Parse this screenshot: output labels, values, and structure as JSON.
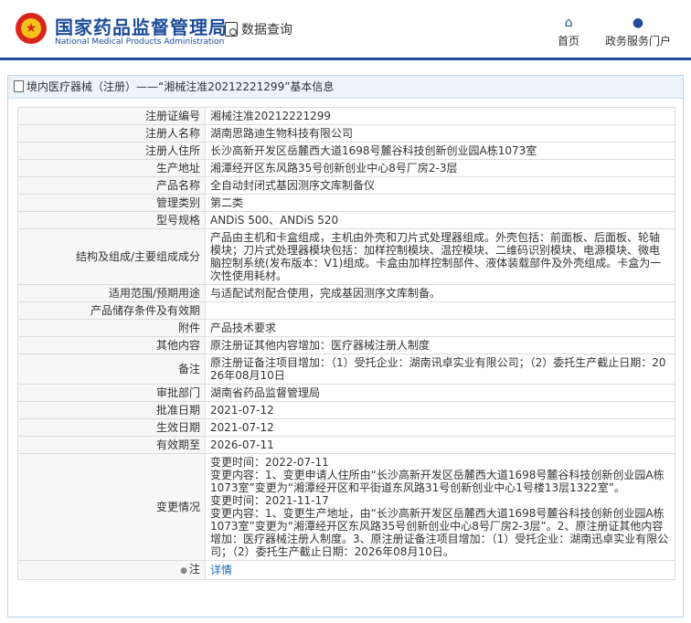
{
  "header": {
    "site_name_cn": "国家药品监督管理局",
    "site_name_en": "National Medical Products Administration",
    "query_label": "数据查询",
    "nav": [
      {
        "label": "首页",
        "icon": "home-icon"
      },
      {
        "label": "政务服务门户",
        "icon": "user-icon"
      }
    ]
  },
  "panel": {
    "title": "境内医疗器械（注册）——“湘械注准20212221299”基本信息"
  },
  "table": {
    "rows": [
      {
        "label": "注册证编号",
        "value": "湘械注准20212221299"
      },
      {
        "label": "注册人名称",
        "value": "湖南思路迪生物科技有限公司"
      },
      {
        "label": "注册人住所",
        "value": "长沙高新开发区岳麓西大道1698号麓谷科技创新创业园A栋1073室"
      },
      {
        "label": "生产地址",
        "value": "湘潭经开区东风路35号创新创业中心8号厂房2-3层"
      },
      {
        "label": "产品名称",
        "value": "全自动封闭式基因测序文库制备仪"
      },
      {
        "label": "管理类别",
        "value": "第二类"
      },
      {
        "label": "型号规格",
        "value": "ANDiS 500、ANDiS 520"
      },
      {
        "label": "结构及组成/主要组成成分",
        "value": "产品由主机和卡盒组成，主机由外壳和刀片式处理器组成。外壳包括：前面板、后面板、轮轴模块；刀片式处理器模块包括：加样控制模块、温控模块、二维码识别模块、电源模块、微电脑控制系统(发布版本：V1)组成。卡盒由加样控制部件、液体装载部件及外壳组成。卡盒为一次性使用耗材。"
      },
      {
        "label": "适用范围/预期用途",
        "value": "与适配试剂配合使用，完成基因测序文库制备。"
      },
      {
        "label": "产品储存条件及有效期",
        "value": ""
      },
      {
        "label": "附件",
        "value": "产品技术要求"
      },
      {
        "label": "其他内容",
        "value": "原注册证其他内容增加：医疗器械注册人制度"
      },
      {
        "label": "备注",
        "value": "原注册证备注项目增加：（1）受托企业：湖南讯卓实业有限公司；（2）委托生产截止日期：2026年08月10日"
      },
      {
        "label": "审批部门",
        "value": "湖南省药品监督管理局"
      },
      {
        "label": "批准日期",
        "value": "2021-07-12"
      },
      {
        "label": "生效日期",
        "value": "2021-07-12"
      },
      {
        "label": "有效期至",
        "value": "2026-07-11"
      }
    ],
    "changes": {
      "label": "变更情况",
      "lines": [
        "变更时间：2022-07-11",
        "变更内容：1、变更申请人住所由“长沙高新开发区岳麓西大道1698号麓谷科技创新创业园A栋1073室”变更为“湘潭经开区和平街道东风路31号创新创业中心1号楼13层1322室”。",
        "变更时间：2021-11-17",
        "变更内容：1、变更生产地址，由“长沙高新开发区岳麓西大道1698号麓谷科技创新创业园A栋1073室”变更为“湘潭经开区东风路35号创新创业中心8号厂房2-3层”。2、原注册证其他内容增加：医疗器械注册人制度。3、原注册证备注项目增加：（1）受托企业：湖南迅卓实业有限公司；（2）委托生产截止日期：2026年08月10日。"
      ]
    },
    "note": {
      "label": "注",
      "icon": "bulb-icon",
      "link": "详情"
    }
  },
  "colors": {
    "brand": "#1d4c9a",
    "link": "#1d6ab8"
  }
}
